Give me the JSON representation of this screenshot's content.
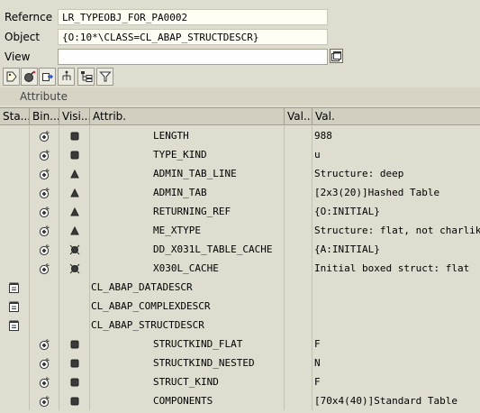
{
  "header": {
    "reference_label": "Refernce",
    "reference_value": "LR_TYPEOBJ_FOR_PA0002",
    "object_label": "Object",
    "object_value": "{O:10*\\CLASS=CL_ABAP_STRUCTDESCR}",
    "view_label": "View",
    "view_value": ""
  },
  "toolbar": {
    "buttons": [
      "tag-icon",
      "bomb-icon",
      "export-icon",
      "hierarchy-icon",
      "tree-icon",
      "filter-icon"
    ]
  },
  "section": {
    "title": "Attribute"
  },
  "grid": {
    "columns": [
      "Sta...",
      "Bin...",
      "Visi...",
      "Attrib.",
      "Val...",
      "Val."
    ],
    "rows": [
      {
        "attr": "LENGTH",
        "val": "988",
        "kind": "attr",
        "vis": "square"
      },
      {
        "attr": "TYPE_KIND",
        "val": "u",
        "kind": "attr",
        "vis": "square"
      },
      {
        "attr": "ADMIN_TAB_LINE",
        "val": "Structure: deep",
        "kind": "attr",
        "vis": "triangle"
      },
      {
        "attr": "ADMIN_TAB",
        "val": "[2x3(20)]Hashed Table",
        "kind": "attr",
        "vis": "triangle"
      },
      {
        "attr": "RETURNING_REF",
        "val": "{O:INITIAL}",
        "kind": "attr",
        "vis": "triangle"
      },
      {
        "attr": "ME_XTYPE",
        "val": "Structure: flat, not charlike",
        "kind": "attr",
        "vis": "triangle"
      },
      {
        "attr": "DD_X031L_TABLE_CACHE",
        "val": "{A:INITIAL}",
        "kind": "attr",
        "vis": "key"
      },
      {
        "attr": "X030L_CACHE",
        "val": "Initial boxed struct: flat",
        "kind": "attr",
        "vis": "key"
      },
      {
        "attr": "CL_ABAP_DATADESCR",
        "val": "",
        "kind": "class",
        "vis": ""
      },
      {
        "attr": "CL_ABAP_COMPLEXDESCR",
        "val": "",
        "kind": "class",
        "vis": ""
      },
      {
        "attr": "CL_ABAP_STRUCTDESCR",
        "val": "",
        "kind": "class",
        "vis": ""
      },
      {
        "attr": "STRUCTKIND_FLAT",
        "val": "F",
        "kind": "attr",
        "vis": "square"
      },
      {
        "attr": "STRUCTKIND_NESTED",
        "val": "N",
        "kind": "attr",
        "vis": "square"
      },
      {
        "attr": "STRUCT_KIND",
        "val": "F",
        "kind": "attr",
        "vis": "square"
      },
      {
        "attr": "COMPONENTS",
        "val": "[70x4(40)]Standard Table",
        "kind": "attr",
        "vis": "square"
      }
    ]
  }
}
